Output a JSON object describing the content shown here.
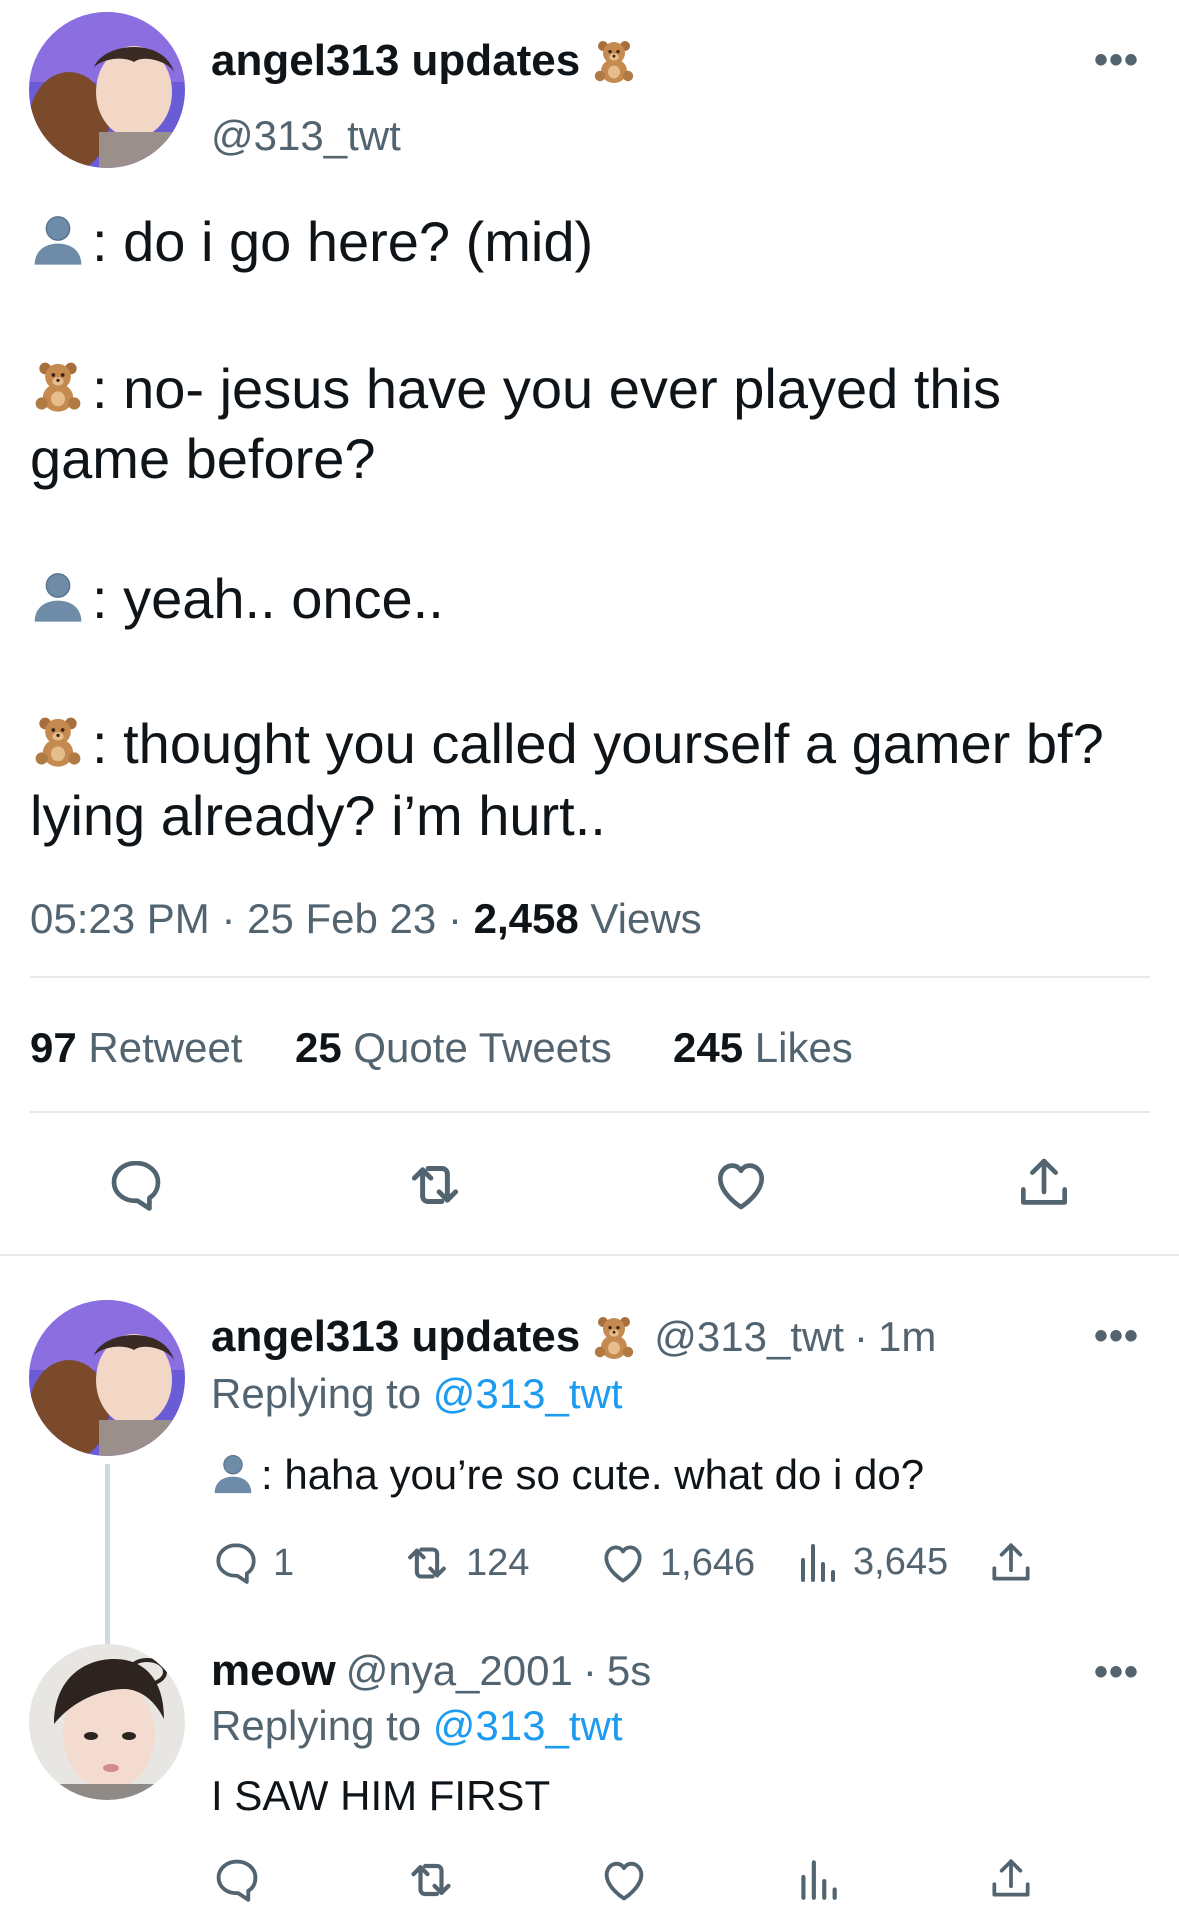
{
  "main_tweet": {
    "author_name": "angel313 updates",
    "author_emoji": "🧸",
    "handle": "@313_twt",
    "lines": [
      {
        "speaker": "person",
        "text": ": do i go here? (mid)"
      },
      {
        "speaker": "bear",
        "text": ": no- jesus have you ever played this"
      },
      {
        "speaker": "none",
        "text": "game before?"
      },
      {
        "speaker": "person",
        "text": ": yeah.. once.."
      },
      {
        "speaker": "bear",
        "text": ": thought you called yourself a gamer bf?"
      },
      {
        "speaker": "none",
        "text": "lying already? i’m hurt.."
      }
    ],
    "time": "05:23 PM",
    "date": "25 Feb 23",
    "views_count": "2,458",
    "views_label": "Views",
    "retweets_count": "97",
    "retweets_label": "Retweet",
    "quotes_count": "25",
    "quotes_label": "Quote Tweets",
    "likes_count": "245",
    "likes_label": "Likes"
  },
  "replies": [
    {
      "author_name": "angel313 updates",
      "author_emoji": "🧸",
      "handle": "@313_twt",
      "time": "1m",
      "replying_to_label": "Replying to",
      "replying_to_handle": "@313_twt",
      "text": ": haha you’re so cute. what do i do?",
      "reply_count": "1",
      "retweet_count": "124",
      "like_count": "1,646",
      "view_count": "3,645"
    },
    {
      "author_name": "meow",
      "handle": "@nya_2001",
      "time": "5s",
      "replying_to_label": "Replying to",
      "replying_to_handle": "@313_twt",
      "text": "I SAW HIM FIRST"
    }
  ],
  "icons": [
    "more-icon",
    "bust-in-silhouette-emoji",
    "teddy-bear-emoji",
    "reply-icon",
    "retweet-icon",
    "like-icon",
    "share-icon",
    "views-icon"
  ],
  "colors": {
    "text": "#0f1419",
    "secondary": "#536471",
    "link": "#1d9bf0",
    "divider": "#e6e9eb"
  }
}
